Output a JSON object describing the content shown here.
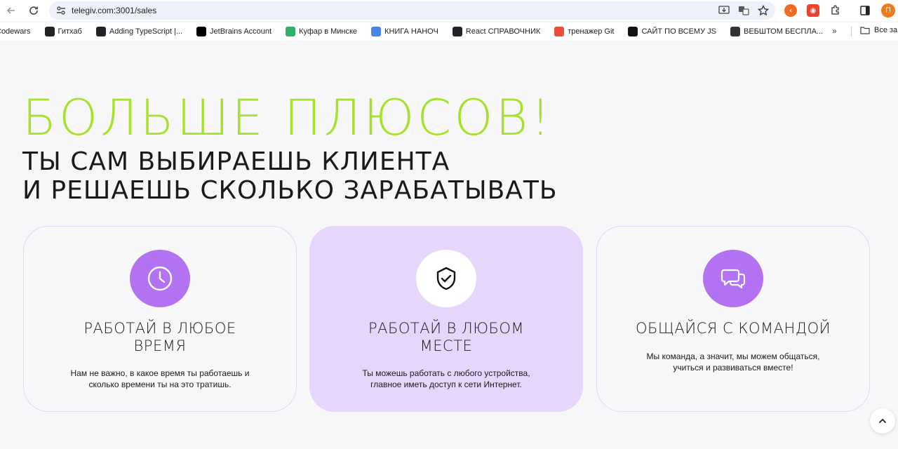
{
  "browser": {
    "url": "telegiv.com:3001/sales",
    "avatar_letter": "П",
    "bookmarks": [
      {
        "label": "Codewars",
        "icon": "codewars-icon",
        "color": "#b1361e"
      },
      {
        "label": "Гитхаб",
        "icon": "github-icon",
        "color": "#222222"
      },
      {
        "label": "Adding TypeScript |...",
        "icon": "typescript-icon",
        "color": "#20232a"
      },
      {
        "label": "JetBrains Account",
        "icon": "jetbrains-icon",
        "color": "#000000"
      },
      {
        "label": "Куфар в Минске",
        "icon": "kufar-icon",
        "color": "#2fb36b"
      },
      {
        "label": "КНИГА НАНОЧ",
        "icon": "docs-icon",
        "color": "#4a86e8"
      },
      {
        "label": "React СПРАВОЧНИК",
        "icon": "react-icon",
        "color": "#20232a"
      },
      {
        "label": "тренажер Git",
        "icon": "git-trainer-icon",
        "color": "#e84d3d"
      },
      {
        "label": "САЙТ ПО ВСЕМУ JS",
        "icon": "js-site-icon",
        "color": "#111111"
      },
      {
        "label": "ВЕБШТОМ БЕСПЛА...",
        "icon": "t-icon",
        "color": "#333333"
      }
    ],
    "all_bookmarks_label": "Все за"
  },
  "hero": {
    "title": "БОЛЬШЕ ПЛЮСОВ!",
    "subtitle_line1": "ТЫ САМ ВЫБИРАЕШЬ КЛИЕНТА",
    "subtitle_line2": "И РЕШАЕШЬ СКОЛЬКО ЗАРАБАТЫВАТЬ"
  },
  "cards": [
    {
      "icon": "clock-icon",
      "title_line1": "РАБОТАЙ В ЛЮБОЕ",
      "title_line2": "ВРЕМЯ",
      "text_line1": "Нам не важно, в какое время ты работаешь и",
      "text_line2": "сколько времени ты на это тратишь."
    },
    {
      "icon": "shield-check-icon",
      "title_line1": "РАБОТАЙ В ЛЮБОМ",
      "title_line2": "МЕСТЕ",
      "text_line1": "Ты можешь работать с любого устройства,",
      "text_line2": "главное иметь доступ к сети Интернет."
    },
    {
      "icon": "chat-bubbles-icon",
      "title_line1": "ОБЩАЙСЯ С КОМАНДОЙ",
      "title_line2": "",
      "text_line1": "Мы команда, а значит, мы можем общаться,",
      "text_line2": "учиться и развиваться вместе!"
    }
  ],
  "colors": {
    "accent_green": "#a8e12a",
    "icon_purple": "#b272f2",
    "active_card": "#e6d6fb"
  }
}
